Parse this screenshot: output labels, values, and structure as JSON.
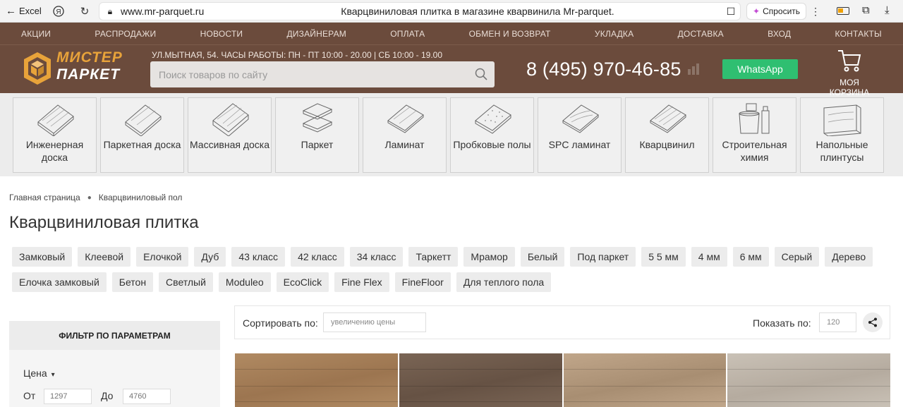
{
  "browser": {
    "back_label": "Excel",
    "url": "www.mr-parquet.ru",
    "page_title": "Кварцвиниловая плитка в магазине кварвинила Mr-parquet.",
    "ask_label": "Спросить"
  },
  "topnav": [
    "АКЦИИ",
    "РАСПРОДАЖИ",
    "НОВОСТИ",
    "ДИЗАЙНЕРАМ",
    "ОПЛАТА",
    "ОБМЕН И ВОЗВРАТ",
    "УКЛАДКА",
    "ДОСТАВКА",
    "ВХОД",
    "КОНТАКТЫ"
  ],
  "header": {
    "logo_line1": "МИСТЕР",
    "logo_line2": "ПАРКЕТ",
    "address": "УЛ.МЫТНАЯ, 54. ЧАСЫ РАБОТЫ: ПН - ПТ 10:00 - 20.00 | СБ 10:00 - 19.00",
    "search_placeholder": "Поиск товаров по сайту",
    "phone": "8 (495) 970-46-85",
    "whatsapp": "WhatsApp",
    "cart": "МОЯ КОРЗИНА"
  },
  "categories": [
    {
      "name": "Инженерная доска",
      "icon": "engineered-board-icon"
    },
    {
      "name": "Паркетная доска",
      "icon": "parquet-board-icon"
    },
    {
      "name": "Массивная доска",
      "icon": "solid-board-icon"
    },
    {
      "name": "Паркет",
      "icon": "parquet-icon"
    },
    {
      "name": "Ламинат",
      "icon": "laminate-icon"
    },
    {
      "name": "Пробковые полы",
      "icon": "cork-floor-icon"
    },
    {
      "name": "SPC ламинат",
      "icon": "spc-laminate-icon"
    },
    {
      "name": "Кварцвинил",
      "icon": "quartz-vinyl-icon"
    },
    {
      "name": "Строительная химия",
      "icon": "construction-chemicals-icon"
    },
    {
      "name": "Напольные плинтусы",
      "icon": "skirting-board-icon"
    }
  ],
  "breadcrumb": [
    "Главная страница",
    "Кварцвиниловый пол"
  ],
  "page_heading": "Кварцвиниловая плитка",
  "tags_row1": [
    "Замковый",
    "Клеевой",
    "Елочкой",
    "Дуб",
    "43 класс",
    "42 класс",
    "34 класс",
    "Таркетт",
    "Мрамор",
    "Белый",
    "Под паркет",
    "5 5 мм",
    "4 мм",
    "6 мм",
    "Серый",
    "Дерево"
  ],
  "tags_row2": [
    "Елочка замковый",
    "Бетон",
    "Светлый",
    "Moduleo",
    "EcoClick",
    "Fine Flex",
    "FineFloor",
    "Для теплого пола"
  ],
  "filter": {
    "title": "ФИЛЬТР ПО ПАРАМЕТРАМ",
    "price_label": "Цена",
    "from_label": "От",
    "to_label": "До",
    "from_value": "1297",
    "to_value": "4760"
  },
  "sortbar": {
    "sort_label": "Сортировать по:",
    "sort_value": "увеличению цены",
    "show_label": "Показать по:",
    "show_value": "120"
  },
  "products": [
    {
      "color_a": "#b08a62",
      "color_b": "#9c7550"
    },
    {
      "color_a": "#7a6555",
      "color_b": "#665244"
    },
    {
      "color_a": "#c0a68a",
      "color_b": "#a88e72"
    },
    {
      "color_a": "#c9c1b6",
      "color_b": "#b5ab9f"
    }
  ],
  "colors": {
    "header_brown": "#6b4b3c",
    "logo_orange": "#e8a33a",
    "whatsapp_green": "#2fbf71"
  }
}
